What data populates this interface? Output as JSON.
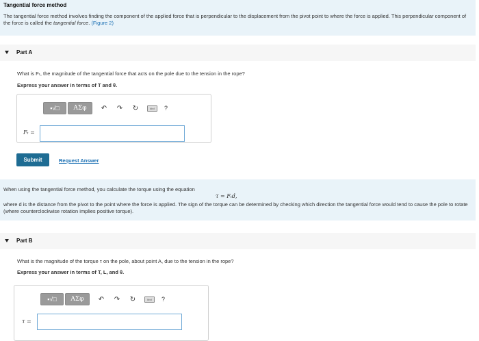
{
  "intro": {
    "title": "Tangential force method",
    "text_part1": "The tangential force method involves finding the component of the applied force that is perpendicular to the displacement from the pivot point to where the force is applied. This perpendicular component of the force is called the ",
    "text_italic": "tangential force",
    "text_part2": ". ",
    "figure_link": "(Figure 2)"
  },
  "partA": {
    "label": "Part A",
    "question": "What is Fₜ, the magnitude of the tangential force that acts on the pole due to the tension in the rope?",
    "instruction": "Express your answer in terms of T and θ.",
    "variable": "Fₜ =",
    "submit_label": "Submit",
    "request_label": "Request Answer"
  },
  "toolbar": {
    "sqrt_label": "▪√□",
    "greek_label": "AΣφ",
    "undo_icon": "↶",
    "redo_icon": "↷",
    "reset_icon": "↻",
    "keyboard_label": "kbd",
    "help_label": "?"
  },
  "info": {
    "line1": "When using the tangential force method, you calculate the torque using the equation",
    "equation": "τ = Fₜd,",
    "line2": "where d is the distance from the pivot to the point where the force is applied. The sign of the torque can be determined by checking which direction the tangential force would tend to cause the pole to rotate (where counterclockwise rotation implies positive torque)."
  },
  "partB": {
    "label": "Part B",
    "question": "What is the magnitude of the torque τ on the pole, about point A, due to the tension in the rope?",
    "instruction": "Express your answer in terms of T, L, and θ.",
    "variable": "τ ="
  }
}
